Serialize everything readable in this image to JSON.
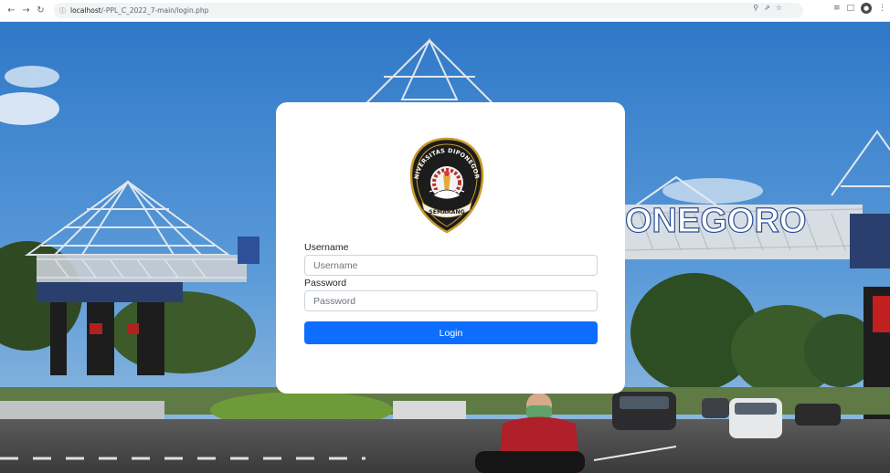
{
  "browser": {
    "url_host": "localhost",
    "url_path": "/-PPL_C_2022_7-main/login.php"
  },
  "scene": {
    "gate_sign": "ONEGORO"
  },
  "login": {
    "logo": {
      "name": "universitas-diponegoro-logo",
      "top_text": "UNIVERSITAS DIPONEGORO",
      "bottom_text": "SEMARANG"
    },
    "username_label": "Username",
    "username_placeholder": "Username",
    "username_value": "",
    "password_label": "Password",
    "password_placeholder": "Password",
    "password_value": "",
    "submit_label": "Login",
    "accent_color": "#0d6efd"
  }
}
